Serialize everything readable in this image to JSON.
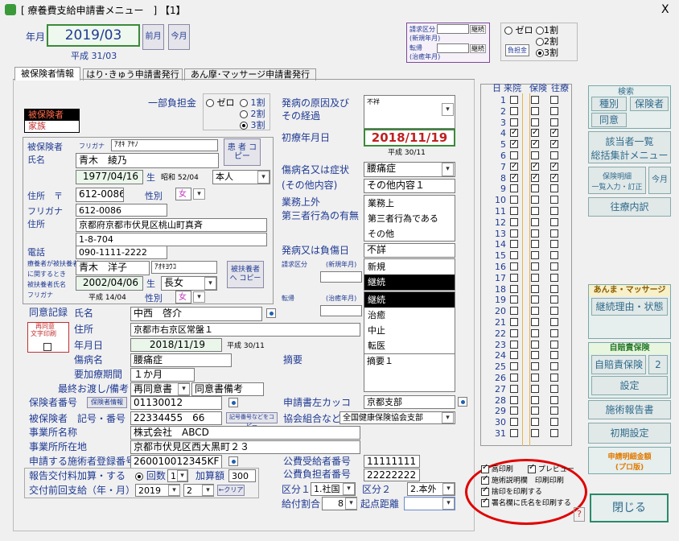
{
  "window": {
    "title": "[ 療養費支給申請書メニュー　] 【1】",
    "close": "X"
  },
  "header": {
    "year_month_label": "年月",
    "year_month": "2019/03",
    "heisei": "平成 31/03",
    "prev_btn": "前月",
    "this_btn": "今月"
  },
  "seikyu": {
    "l1": "請求区分",
    "l1b": "(新規年月)",
    "l2": "転帰",
    "l2b": "(治癒年月)",
    "b1": "継続",
    "b2": "継続"
  },
  "futan_top": {
    "zero": "ゼロ",
    "w1": "1割",
    "w2": "2割",
    "w3": "3割",
    "btn": "負担金"
  },
  "tabs": [
    "被保険者情報",
    "はり･きゅう申請書発行",
    "あん摩･マッサージ申請書発行"
  ],
  "left": {
    "type_list": [
      "被保険者",
      "家族"
    ],
    "furigana_lbl": "フリガナ",
    "furigana": "ｱｵｷ ｱﾔﾉ",
    "copy_btn": "患 者 コピー",
    "hihoken_lbl": "被保険者",
    "name_lbl": "氏名",
    "name": "青木　綾乃",
    "birth": "1977/04/16",
    "birth_suffix": "生",
    "showa": "昭和 52/04",
    "relation": "本人",
    "addr_lbl": "住所　〒",
    "zip": "612-0086",
    "sex_lbl": "性別",
    "sex": "女",
    "furigana2_lbl": "フリガナ",
    "zip2": "612-0086",
    "addr2_lbl": "住所",
    "addr": "京都府京都市伏見区桃山町真斉",
    "addr_b": "1-8-704",
    "tel_lbl": "電話",
    "tel": "090-1111-2222",
    "dep_l1": "療養者が被扶養者",
    "dep_l2": "に関するとき",
    "dep_l3": "被扶養者氏名",
    "dep_l4": "フリガナ",
    "dep_name": "青木　洋子",
    "dep_kana": "ｱｵｷﾖｳｺ",
    "dep_copy_btn": "被扶養者へ コピー",
    "dep_birth": "2002/04/06",
    "dep_rel": "長女",
    "dep_heisei": "平成 14/04",
    "dep_sex": "女"
  },
  "futan": {
    "label": "一部負担金",
    "zero": "ゼロ",
    "w1": "1割",
    "w2": "2割",
    "w3": "3割"
  },
  "mid": {
    "cause_lbl1": "発病の原因及び",
    "cause_lbl2": "その経過",
    "cause": "不祥",
    "first_lbl": "初療年月日",
    "first": "2018/11/19",
    "first_heisei": "平成 30/11",
    "disease_lbl": "傷病名又は症状",
    "disease": "腰痛症",
    "other_lbl": "(その他内容)",
    "other": "その他内容１",
    "work_lbl1": "業務上外",
    "work_lbl2": "第三者行為の有無",
    "work_list": [
      "業務上",
      "第三者行為である",
      "その他"
    ],
    "onset_lbl": "発病又は負傷日",
    "onset": "不詳",
    "req_lbl": "請求区分",
    "req_sub": "(新規年月)",
    "req_list": [
      "新規",
      "継続"
    ],
    "tenki_lbl": "転帰",
    "tenki_sub": "(治癒年月)",
    "tenki_list": [
      "継続",
      "治癒",
      "中止",
      "転医"
    ]
  },
  "consent": {
    "rec_lbl": "同意記録",
    "reprint1": "再同意",
    "reprint2": "文字印刷",
    "name_lbl": "氏名",
    "name": "中西　啓介",
    "addr_lbl": "住所",
    "addr": "京都市右京区常盤１",
    "date_lbl": "年月日",
    "date": "2018/11/19",
    "date_heisei": "平成 30/11",
    "dis_lbl": "傷病名",
    "dis": "腰痛症",
    "memo_lbl": "摘要",
    "memo": "摘要１",
    "period_lbl": "要加療期間",
    "period": "１か月",
    "final_lbl": "最終お渡し/備考",
    "final": "再同意書",
    "note": "同意書備考"
  },
  "insurer": {
    "num_lbl": "保険者番号",
    "info_btn": "保険者情報",
    "num": "01130012",
    "insnum_lbl": "被保険者　記号・番号",
    "insnum": "22334455　66",
    "copy_btn": "記号番号などをコピー",
    "kyokai_lbl": "協会組合など",
    "kyokai": "全国健康保険協会支部",
    "office_lbl": "事業所名称",
    "office": "株式会社　ABCD",
    "office_addr_lbl": "事業所所在地",
    "office_addr": "京都市伏見区西大黒町２３",
    "reg_lbl": "申請する施術者登録番号",
    "reg": "260010012345KF",
    "kakko_lbl": "申請書左カッコ",
    "kakko": "京都支部",
    "pub_lbl": "公費受給者番号",
    "pub": "11111111",
    "pub2_lbl": "公費負担者番号",
    "pub2": "22222222",
    "rep_lbl": "報告交付料加算・する",
    "times_lbl": "回数",
    "times": "1",
    "add_lbl": "加算額",
    "add": "300",
    "prev_lbl": "交付前回支給（年・月）",
    "prev_y": "2019",
    "prev_m": "2",
    "clear_btn": "←クリア",
    "kubun1_lbl": "区分１",
    "kubun1": "1.社国",
    "kubun2_lbl": "区分２",
    "kubun2": "2.本外",
    "ratio_lbl": "給付割合",
    "ratio": "8",
    "dist_lbl": "起点距離"
  },
  "days": {
    "h_day": "日",
    "h_visit": "来院",
    "h_ins": "保険",
    "h_ret": "往療",
    "rows": [
      {
        "d": "1",
        "v": false,
        "i": false,
        "r": false
      },
      {
        "d": "2",
        "v": false,
        "i": false,
        "r": false
      },
      {
        "d": "3",
        "v": false,
        "i": false,
        "r": false
      },
      {
        "d": "4",
        "v": true,
        "i": true,
        "r": true
      },
      {
        "d": "5",
        "v": true,
        "i": true,
        "r": true
      },
      {
        "d": "6",
        "v": false,
        "i": false,
        "r": false
      },
      {
        "d": "7",
        "v": true,
        "i": true,
        "r": true
      },
      {
        "d": "8",
        "v": true,
        "i": true,
        "r": true
      },
      {
        "d": "9",
        "v": false,
        "i": false,
        "r": false
      },
      {
        "d": "10",
        "v": false,
        "i": false,
        "r": false
      },
      {
        "d": "11",
        "v": false,
        "i": false,
        "r": false
      },
      {
        "d": "12",
        "v": false,
        "i": false,
        "r": false
      },
      {
        "d": "13",
        "v": false,
        "i": false,
        "r": false
      },
      {
        "d": "14",
        "v": false,
        "i": false,
        "r": false
      },
      {
        "d": "15",
        "v": false,
        "i": false,
        "r": false
      },
      {
        "d": "16",
        "v": false,
        "i": false,
        "r": false
      },
      {
        "d": "17",
        "v": false,
        "i": false,
        "r": false
      },
      {
        "d": "18",
        "v": false,
        "i": false,
        "r": false
      },
      {
        "d": "19",
        "v": false,
        "i": false,
        "r": false
      },
      {
        "d": "20",
        "v": false,
        "i": false,
        "r": false
      },
      {
        "d": "21",
        "v": false,
        "i": false,
        "r": false
      },
      {
        "d": "22",
        "v": false,
        "i": false,
        "r": false
      },
      {
        "d": "23",
        "v": false,
        "i": false,
        "r": false
      },
      {
        "d": "24",
        "v": false,
        "i": false,
        "r": false
      },
      {
        "d": "25",
        "v": false,
        "i": false,
        "r": false
      },
      {
        "d": "26",
        "v": false,
        "i": false,
        "r": false
      },
      {
        "d": "27",
        "v": false,
        "i": false,
        "r": false
      },
      {
        "d": "28",
        "v": false,
        "i": false,
        "r": false
      },
      {
        "d": "29",
        "v": false,
        "i": false,
        "r": false
      },
      {
        "d": "30",
        "v": false,
        "i": false,
        "r": false
      },
      {
        "d": "31",
        "v": false,
        "i": false,
        "r": false
      }
    ]
  },
  "print": {
    "stamp": "高印刷",
    "preview": "プレビュー",
    "detail": "施術説明欄　印刷印刷",
    "hide": "捨印を印刷する",
    "signature": "署名欄に氏名を印刷する"
  },
  "right": {
    "search_title": "検索",
    "category": "種別",
    "insurer": "保険者",
    "consent": "同意",
    "summary1": "該当者一覧",
    "summary2": "総括集計メニュー",
    "detail1": "保険明細",
    "detail2": "一覧入力・訂正",
    "today": "今月",
    "visit": "往療内訳",
    "anma_title": "あんま・マッサージ",
    "reason": "継続理由・状態",
    "self_title": "自賠責保険",
    "self_btn": "自賠責保険",
    "self_num": "2",
    "settings": "設定",
    "report": "施術報告書",
    "initial": "初期設定",
    "pro_line1": "申請明細金額",
    "pro_line2": "(プロ版)",
    "close": "閉じる",
    "help": "?"
  }
}
